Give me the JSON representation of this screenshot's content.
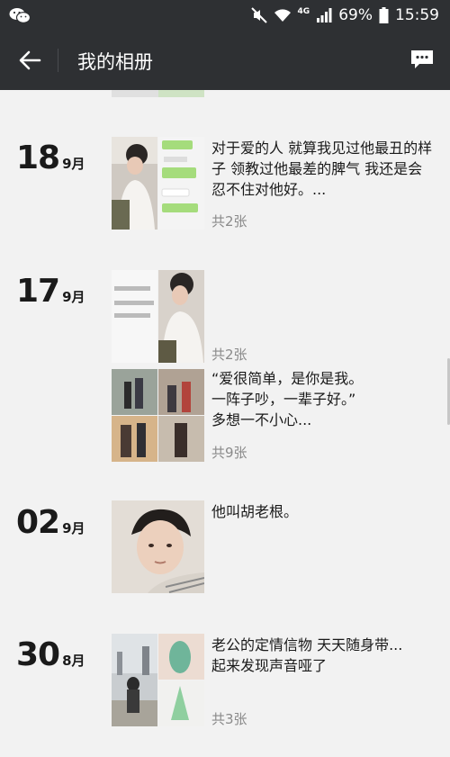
{
  "status": {
    "battery": "69%",
    "time": "15:59",
    "network": "4G"
  },
  "header": {
    "title": "我的相册"
  },
  "posts": [
    {
      "day": "18",
      "month": "9月",
      "caption": "对于爱的人 就算我见过他最丑的样子 领教过他最差的脾气 我还是会忍不住对他好。...",
      "count": "共2张"
    },
    {
      "day": "17",
      "month": "9月",
      "caption": "",
      "count": "共2张"
    },
    {
      "caption": "“爱很简单，是你是我。\n一阵子吵，一辈子好。”\n多想一不小心...",
      "count": "共9张"
    },
    {
      "day": "02",
      "month": "9月",
      "caption": "他叫胡老根。",
      "count": ""
    },
    {
      "day": "30",
      "month": "8月",
      "caption": "老公的定情信物 天天随身带...\n起来发现声音哑了",
      "count": "共3张"
    }
  ],
  "colors": {
    "bar": "#2e3033",
    "bg": "#f2f2f2",
    "count": "#8a8a8a"
  },
  "icons": [
    "wechat-icon",
    "mute-icon",
    "wifi-icon",
    "signal-icon",
    "battery-icon",
    "back-arrow-icon",
    "message-icon"
  ]
}
